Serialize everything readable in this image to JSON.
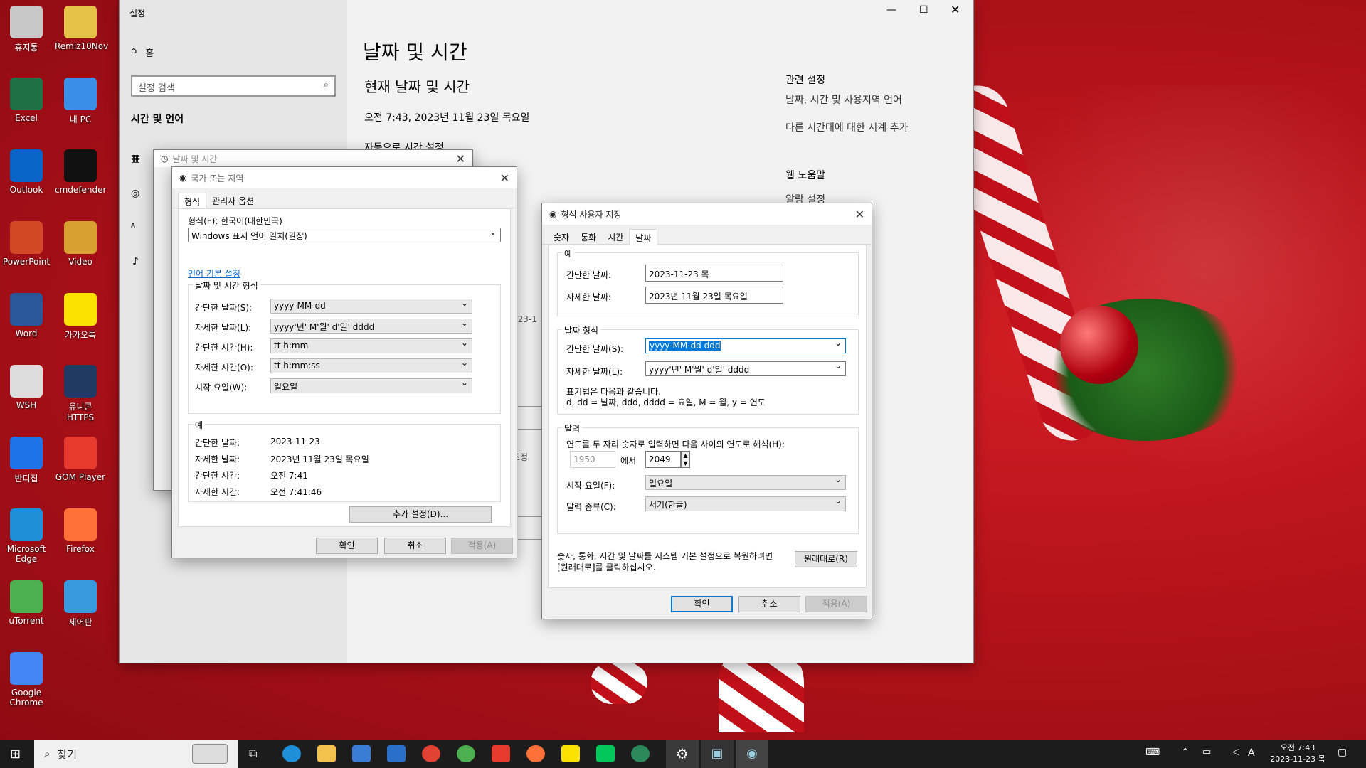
{
  "desktop": {
    "icons": [
      {
        "label": "휴지통",
        "icon": "recycle-bin-icon",
        "color": "#c8c8c8"
      },
      {
        "label": "Remiz10Nov",
        "icon": "user-folder-icon",
        "color": "#e6c24a"
      },
      {
        "label": "Excel",
        "icon": "excel-icon",
        "color": "#1e7145"
      },
      {
        "label": "내 PC",
        "icon": "computer-icon",
        "color": "#3a8ee6"
      },
      {
        "label": "Outlook",
        "icon": "outlook-icon",
        "color": "#0a64c8"
      },
      {
        "label": "cmdefender",
        "icon": "console-icon",
        "color": "#111111"
      },
      {
        "label": "PowerPoint",
        "icon": "powerpoint-icon",
        "color": "#d24726"
      },
      {
        "label": "Video",
        "icon": "video-folder-icon",
        "color": "#d8a030"
      },
      {
        "label": "Word",
        "icon": "word-icon",
        "color": "#2b579a"
      },
      {
        "label": "카카오톡",
        "icon": "kakaotalk-icon",
        "color": "#fae100"
      },
      {
        "label": "WSH",
        "icon": "script-file-icon",
        "color": "#dddddd"
      },
      {
        "label": "유니콘 HTTPS",
        "icon": "unicorn-icon",
        "color": "#1f3a63"
      },
      {
        "label": "반디집",
        "icon": "bandizip-icon",
        "color": "#1e73e8"
      },
      {
        "label": "GOM Player",
        "icon": "gom-player-icon",
        "color": "#e73a2e"
      },
      {
        "label": "Microsoft Edge",
        "icon": "edge-icon",
        "color": "#1e8fd8"
      },
      {
        "label": "Firefox",
        "icon": "firefox-icon",
        "color": "#ff7139"
      },
      {
        "label": "uTorrent",
        "icon": "utorrent-icon",
        "color": "#4caf50"
      },
      {
        "label": "제어판",
        "icon": "control-panel-icon",
        "color": "#3a9ae0"
      },
      {
        "label": "Google Chrome",
        "icon": "chrome-icon",
        "color": "#4285f4"
      }
    ]
  },
  "settings": {
    "window_title": "설정",
    "home": "홈",
    "search_placeholder": "설정 검색",
    "section": "시간 및 언어",
    "page_title": "날짜 및 시간",
    "subtitle": "현재 날짜 및 시간",
    "current": "오전 7:43, 2023년 11월 23일 목요일",
    "auto_time": "자동으로 시간 설정",
    "peek1": "023-1",
    "peek2": "조정",
    "related_title": "관련 설정",
    "related1": "날짜, 시간 및 사용지역 언어",
    "related2": "다른 시간대에 대한 시계 추가",
    "help_title": "웹 도움말",
    "help1": "알람 설정"
  },
  "datetime_dialog": {
    "title": "날짜 및 시간"
  },
  "region": {
    "title": "국가 또는 지역",
    "tabs": [
      "형식",
      "관리자 옵션"
    ],
    "format_label": "형식(F): 한국어(대한민국)",
    "format_value": "Windows 표시 언어 일치(권장)",
    "lang_link": "언어 기본 설정",
    "group_title": "날짜 및 시간 형식",
    "rows": [
      {
        "label": "간단한 날짜(S):",
        "value": "yyyy-MM-dd"
      },
      {
        "label": "자세한 날짜(L):",
        "value": "yyyy'년' M'월' d'일' dddd"
      },
      {
        "label": "간단한 시간(H):",
        "value": "tt h:mm"
      },
      {
        "label": "자세한 시간(O):",
        "value": "tt h:mm:ss"
      },
      {
        "label": "시작 요일(W):",
        "value": "일요일"
      }
    ],
    "example_title": "예",
    "examples": [
      {
        "label": "간단한 날짜:",
        "value": "2023-11-23"
      },
      {
        "label": "자세한 날짜:",
        "value": "2023년 11월 23일 목요일"
      },
      {
        "label": "간단한 시간:",
        "value": "오전 7:41"
      },
      {
        "label": "자세한 시간:",
        "value": "오전 7:41:46"
      }
    ],
    "more": "추가 설정(D)...",
    "ok": "확인",
    "cancel": "취소",
    "apply": "적용(A)"
  },
  "custom": {
    "title": "형식 사용자 지정",
    "tabs": [
      "숫자",
      "통화",
      "시간",
      "날짜"
    ],
    "example_title": "예",
    "ex_short_label": "간단한 날짜:",
    "ex_short": "2023-11-23 목",
    "ex_long_label": "자세한 날짜:",
    "ex_long": "2023년 11월 23일 목요일",
    "fmt_title": "날짜 형식",
    "short_label": "간단한 날짜(S):",
    "short_value": "yyyy-MM-dd ddd",
    "long_label": "자세한 날짜(L):",
    "long_value": "yyyy'년' M'월' d'일' dddd",
    "notation1": "표기법은 다음과 같습니다.",
    "notation2": "d, dd = 날짜,  ddd, dddd = 요일,  M = 월,  y = 연도",
    "cal_title": "달력",
    "cal_desc": "연도를 두 자리 숫자로 입력하면 다음 사이의 연도로 해석(H):",
    "year_from": "1950",
    "between": "에서",
    "year_to": "2049",
    "first_day_label": "시작 요일(F):",
    "first_day": "일요일",
    "cal_type_label": "달력 종류(C):",
    "cal_type": "서기(한글)",
    "reset_text1": "숫자, 통화, 시간 및 날짜를 시스템 기본 설정으로 복원하려면",
    "reset_text2": "[원래대로]를 클릭하십시오.",
    "reset": "원래대로(R)",
    "ok": "확인",
    "cancel": "취소",
    "apply": "적용(A)"
  },
  "taskbar": {
    "search": "찾기",
    "clock_time": "오전 7:43",
    "clock_date": "2023-11-23 목",
    "ime": "A"
  }
}
